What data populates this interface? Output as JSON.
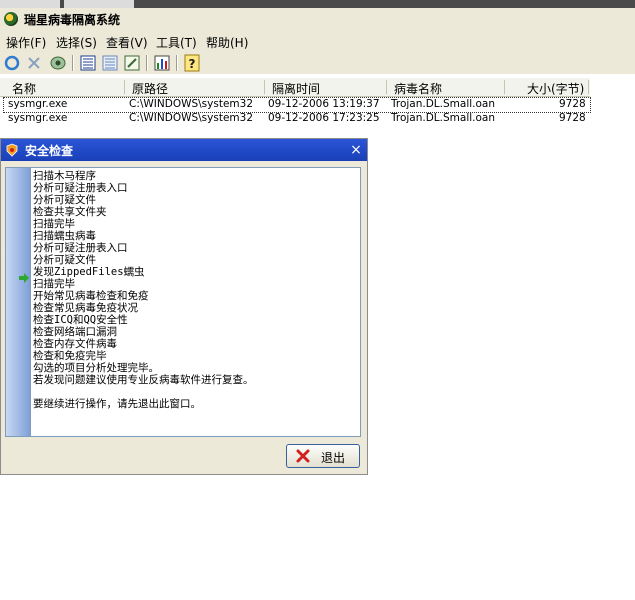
{
  "window": {
    "title": "瑞星病毒隔离系统"
  },
  "menu": [
    {
      "label": "操作(F)"
    },
    {
      "label": "选择(S)"
    },
    {
      "label": "查看(V)"
    },
    {
      "label": "工具(T)"
    },
    {
      "label": "帮助(H)"
    }
  ],
  "toolbar": {
    "buttons": [
      {
        "icon": "refresh-icon"
      },
      {
        "icon": "delete-icon"
      },
      {
        "icon": "restore-icon"
      },
      {
        "icon": "list-view-icon"
      },
      {
        "icon": "detail-view-icon"
      },
      {
        "icon": "properties-icon"
      },
      {
        "icon": "chart-icon"
      },
      {
        "icon": "help-icon"
      }
    ]
  },
  "list": {
    "columns": [
      "名称",
      "原路径",
      "隔离时间",
      "病毒名称",
      "大小(字节)"
    ],
    "rows": [
      {
        "name": "sysmgr.exe",
        "path": "C:\\WINDOWS\\system32",
        "time": "09-12-2006 13:19:37",
        "virus": "Trojan.DL.Small.oan",
        "size": "9728"
      },
      {
        "name": "sysmgr.exe",
        "path": "C:\\WINDOWS\\system32",
        "time": "09-12-2006 17:23:25",
        "virus": "Trojan.DL.Small.oan",
        "size": "9728"
      }
    ]
  },
  "dialog": {
    "title": "安全检查",
    "close": "×",
    "log": [
      "扫描木马程序",
      "  分析可疑注册表入口",
      "  分析可疑文件",
      "  检查共享文件夹",
      "  扫描完毕",
      "扫描蠕虫病毒",
      "  分析可疑注册表入口",
      "  分析可疑文件",
      "发现ZippedFiles蠕虫",
      "  扫描完毕",
      "开始常见病毒检查和免疫",
      "  检查常见病毒免疫状况",
      "  检查ICQ和QQ安全性",
      "  检查网络端口漏洞",
      "  检查内存文件病毒",
      "  检查和免疫完毕",
      "勾选的项目分析处理完毕。",
      "若发现问题建议使用专业反病毒软件进行复查。",
      "",
      "要继续进行操作，请先退出此窗口。"
    ],
    "exit_label": "退出"
  },
  "colors": {
    "title_bar": "#1a3fb8",
    "menu_bg": "#ece9d8",
    "gutter": "#7e9fd8",
    "arrow": "#2fa82f",
    "exit_icon": "#d02020"
  }
}
